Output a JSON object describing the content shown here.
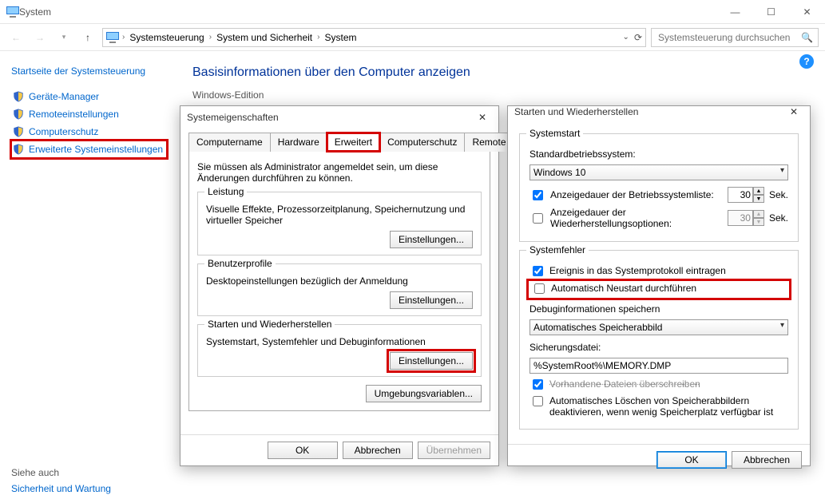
{
  "window": {
    "title": "System",
    "search_placeholder": "Systemsteuerung durchsuchen"
  },
  "breadcrumb": {
    "seg1": "Systemsteuerung",
    "seg2": "System und Sicherheit",
    "seg3": "System"
  },
  "sidebar": {
    "home": "Startseite der Systemsteuerung",
    "items": [
      {
        "label": "Geräte-Manager"
      },
      {
        "label": "Remoteeinstellungen"
      },
      {
        "label": "Computerschutz"
      },
      {
        "label": "Erweiterte Systemeinstellungen"
      }
    ],
    "see_also_heading": "Siehe auch",
    "see_also_link": "Sicherheit und Wartung"
  },
  "content": {
    "heading": "Basisinformationen über den Computer anzeigen",
    "subhead": "Windows-Edition"
  },
  "dialog_props": {
    "title": "Systemeigenschaften",
    "tabs": {
      "t1": "Computername",
      "t2": "Hardware",
      "t3": "Erweitert",
      "t4": "Computerschutz",
      "t5": "Remote"
    },
    "admin_note": "Sie müssen als Administrator angemeldet sein, um diese Änderungen durchführen zu können.",
    "group_perf_title": "Leistung",
    "group_perf_desc": "Visuelle Effekte, Prozessorzeitplanung, Speichernutzung und virtueller Speicher",
    "group_profile_title": "Benutzerprofile",
    "group_profile_desc": "Desktopeinstellungen bezüglich der Anmeldung",
    "group_start_title": "Starten und Wiederherstellen",
    "group_start_desc": "Systemstart, Systemfehler und Debuginformationen",
    "settings_btn": "Einstellungen...",
    "envvars_btn": "Umgebungsvariablen...",
    "ok": "OK",
    "cancel": "Abbrechen",
    "apply": "Übernehmen"
  },
  "dialog_start": {
    "title": "Starten und Wiederherstellen",
    "group_boot": "Systemstart",
    "default_os_label": "Standardbetriebssystem:",
    "default_os_value": "Windows 10",
    "show_list_label": "Anzeigedauer der Betriebssystemliste:",
    "show_list_value": "30",
    "seconds": "Sek.",
    "show_recovery_label": "Anzeigedauer der Wiederherstellungsoptionen:",
    "show_recovery_value": "30",
    "group_fail": "Systemfehler",
    "write_event_label": "Ereignis in das Systemprotokoll eintragen",
    "auto_restart_label": "Automatisch Neustart durchführen",
    "debug_info_label": "Debuginformationen speichern",
    "dump_type_value": "Automatisches Speicherabbild",
    "dump_file_label": "Sicherungsdatei:",
    "dump_file_value": "%SystemRoot%\\MEMORY.DMP",
    "overwrite_label": "Vorhandene Dateien überschreiben",
    "auto_delete_label": "Automatisches Löschen von Speicherabbildern deaktivieren, wenn wenig Speicherplatz verfügbar ist",
    "ok": "OK",
    "cancel": "Abbrechen"
  }
}
